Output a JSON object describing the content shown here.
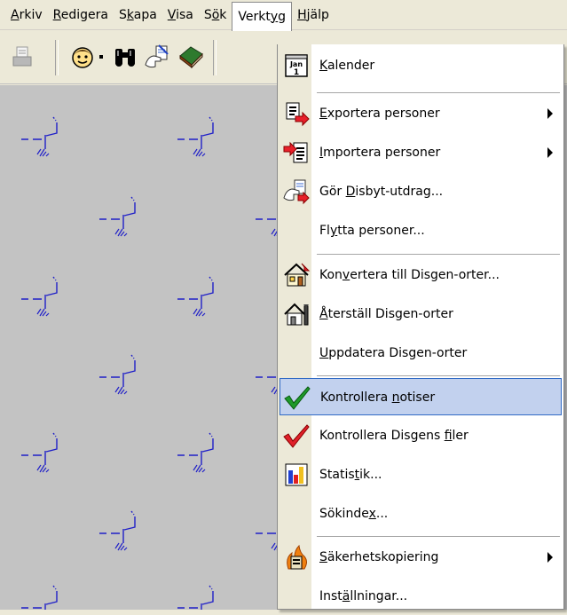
{
  "menubar": [
    {
      "pre": "",
      "acc": "A",
      "post": "rkiv"
    },
    {
      "pre": "",
      "acc": "R",
      "post": "edigera"
    },
    {
      "pre": "S",
      "acc": "k",
      "post": "apa"
    },
    {
      "pre": "",
      "acc": "V",
      "post": "isa"
    },
    {
      "pre": "S",
      "acc": "ö",
      "post": "k"
    },
    {
      "pre": "Verkt",
      "acc": "y",
      "post": "g"
    },
    {
      "pre": "",
      "acc": "H",
      "post": "jälp"
    }
  ],
  "calendar_icon": {
    "top": "Jan",
    "bottom": "1"
  },
  "menu_items": [
    {
      "pre": "",
      "acc": "K",
      "post": "alender",
      "icon": "calendar-icon"
    },
    {
      "pre": "",
      "acc": "E",
      "post": "xportera personer",
      "icon": "export-icon",
      "submenu": true
    },
    {
      "pre": "",
      "acc": "I",
      "post": "mportera personer",
      "icon": "import-icon",
      "submenu": true
    },
    {
      "pre": "Gör ",
      "acc": "D",
      "post": "isbyt-utdrag...",
      "icon": "disbyt-extract-icon"
    },
    {
      "pre": "Fl",
      "acc": "y",
      "post": "tta personer...",
      "icon": ""
    },
    {
      "pre": "Kon",
      "acc": "v",
      "post": "ertera till Disgen-orter...",
      "icon": "house-convert-icon"
    },
    {
      "pre": "",
      "acc": "Å",
      "post": "terställ Disgen-orter",
      "icon": "house-restore-icon"
    },
    {
      "pre": "",
      "acc": "U",
      "post": "ppdatera Disgen-orter",
      "icon": ""
    },
    {
      "pre": "Kontrollera ",
      "acc": "n",
      "post": "otiser",
      "icon": "green-check-icon",
      "highlighted": true
    },
    {
      "pre": "Kontrollera Disgens ",
      "acc": "f",
      "post": "iler",
      "icon": "red-check-icon"
    },
    {
      "pre": "Statis",
      "acc": "t",
      "post": "ik...",
      "icon": "bar-chart-icon"
    },
    {
      "pre": "Sökinde",
      "acc": "x",
      "post": "...",
      "icon": ""
    },
    {
      "pre": "",
      "acc": "S",
      "post": "äkerhetskopiering",
      "icon": "backup-fire-icon",
      "submenu": true
    },
    {
      "pre": "Inst",
      "acc": "ä",
      "post": "llningar...",
      "icon": ""
    }
  ]
}
